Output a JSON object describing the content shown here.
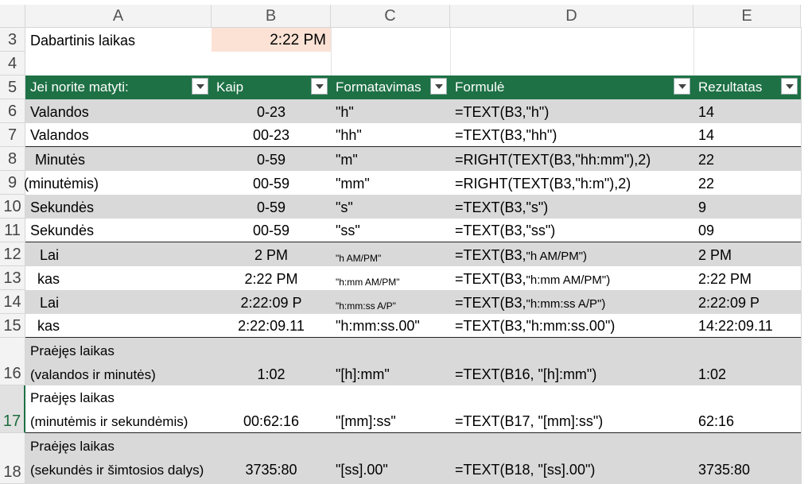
{
  "columns": [
    "A",
    "B",
    "C",
    "D",
    "E"
  ],
  "row3": {
    "num": "3",
    "label": "Dabartinis laikas",
    "value": "2:22 PM"
  },
  "row4": {
    "num": "4"
  },
  "header": {
    "num": "5",
    "a": "Jei norite matyti:",
    "b": "Kaip",
    "c": "Formatavimas",
    "d": "Formulė",
    "e": "Rezultatas"
  },
  "rows": [
    {
      "num": "6",
      "a": "Valandos",
      "b": "0-23",
      "c": "\"h\"",
      "d": "=TEXT(B3,\"h\")",
      "e": "14"
    },
    {
      "num": "7",
      "a": "Valandos",
      "b": "00-23",
      "c": "\"hh\"",
      "d": "=TEXT(B3,\"hh\")",
      "e": "14"
    },
    {
      "num": "8",
      "a": " Minutės",
      "b": "0-59",
      "c": "\"m\"",
      "d": "=RIGHT(TEXT(B3,\"hh:mm\"),2)",
      "e": "22"
    },
    {
      "num": "9",
      "a": "(minutėmis)",
      "b": "00-59",
      "c": "\"mm\"",
      "d": "=RIGHT(TEXT(B3,\"h:m\"),2)",
      "e": "22"
    },
    {
      "num": "10",
      "a": "Sekundės",
      "b": "0-59",
      "c": "\"s\"",
      "d": "=TEXT(B3,\"s\")",
      "e": "9"
    },
    {
      "num": "11",
      "a": "Sekundės",
      "b": "00-59",
      "c": "\"ss\"",
      "d": "=TEXT(B3,\"ss\")",
      "e": "09"
    },
    {
      "num": "12",
      "a": "Lai",
      "b": "2 PM",
      "c": "\"h AM/PM\"",
      "d1": "=TEXT(B3,",
      "d2": "\"h AM/PM\")",
      "e": "2 PM"
    },
    {
      "num": "13",
      "a": "kas",
      "b": "2:22 PM",
      "c": "\"h:mm AM/PM\"",
      "d1": "=TEXT(B3,",
      "d2": "\"h:mm AM/PM\")",
      "e": "2:22 PM"
    },
    {
      "num": "14",
      "a": "Lai",
      "b": "2:22:09 P",
      "c": "\"h:mm:ss A/P\"",
      "d1": "=TEXT(B3,",
      "d2": "\"h:mm:ss A/P\")",
      "e": "2:22:09 P"
    },
    {
      "num": "15",
      "a": "kas",
      "b": "2:22:09.11",
      "c": "\"h:mm:ss.00\"",
      "d": "=TEXT(B3,\"h:mm:ss.00\")",
      "e": "14:22:09.11"
    },
    {
      "num": "16",
      "a1": "Praėjęs laikas",
      "a2": "(valandos ir minutės)",
      "b": "1:02",
      "c": "\"[h]:mm\"",
      "d": "=TEXT(B16, \"[h]:mm\")",
      "e": "1:02"
    },
    {
      "num": "17",
      "a1": "Praėjęs laikas",
      "a2": "(minutėmis ir sekundėmis)",
      "b": "00:62:16",
      "c": "\"[mm]:ss\"",
      "d": "=TEXT(B17, \"[mm]:ss\")",
      "e": "62:16"
    },
    {
      "num": "18",
      "a1": "Praėjęs laikas",
      "a2": "(sekundės ir šimtosios dalys)",
      "b": "3735:80",
      "c": "\"[ss].00\"",
      "d": "=TEXT(B18, \"[ss].00\")",
      "e": "3735:80"
    }
  ],
  "colors": {
    "header_bg": "#1e7145",
    "shade": "#d9d9d9",
    "selected_cell": "#fbe2d5"
  }
}
